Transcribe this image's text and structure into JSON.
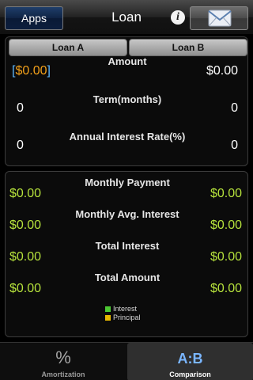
{
  "header": {
    "apps_label": "Apps",
    "title": "Loan",
    "info_glyph": "i",
    "mail_icon": "envelope-icon"
  },
  "segments": {
    "loan_a": "Loan A",
    "loan_b": "Loan B",
    "selected": "Loan B"
  },
  "inputs": {
    "amount_label": "Amount",
    "amount_a_bracket_open": "[",
    "amount_a": "$0.00",
    "amount_a_bracket_close": "]",
    "amount_b": "$0.00",
    "term_label": "Term(months)",
    "term_a": "0",
    "term_b": "0",
    "rate_label": "Annual Interest Rate(%)",
    "rate_a": "0",
    "rate_b": "0"
  },
  "results": {
    "monthly_payment_label": "Monthly Payment",
    "monthly_payment_a": "$0.00",
    "monthly_payment_b": "$0.00",
    "monthly_avg_interest_label": "Monthly Avg. Interest",
    "monthly_avg_interest_a": "$0.00",
    "monthly_avg_interest_b": "$0.00",
    "total_interest_label": "Total Interest",
    "total_interest_a": "$0.00",
    "total_interest_b": "$0.00",
    "total_amount_label": "Total Amount",
    "total_amount_a": "$0.00",
    "total_amount_b": "$0.00"
  },
  "legend": {
    "interest_label": "Interest",
    "interest_color": "#4cc832",
    "principal_label": "Principal",
    "principal_color": "#e6b800"
  },
  "tabs": {
    "amortization_glyph": "%",
    "amortization_label": "Amortization",
    "comparison_glyph": "A:B",
    "comparison_label": "Comparison",
    "selected": "Comparison"
  },
  "colors": {
    "result_value": "#b6e23c",
    "selected_input": "#f3a11a",
    "bracket": "#5fb8ff"
  }
}
